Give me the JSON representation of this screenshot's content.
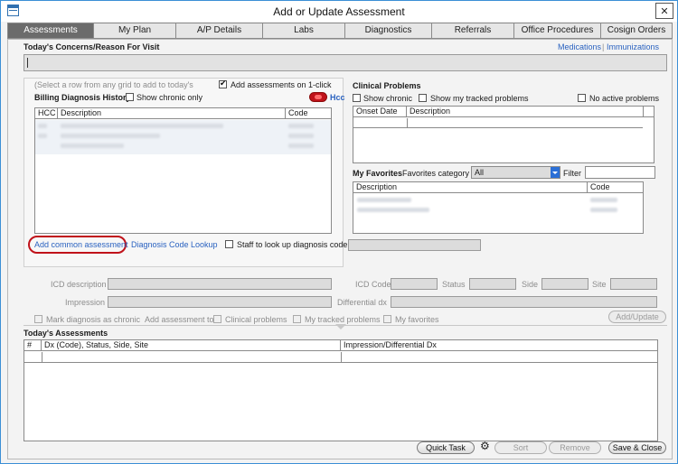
{
  "window": {
    "title": "Add or Update Assessment"
  },
  "tabs": [
    "Assessments",
    "My Plan",
    "A/P Details",
    "Labs",
    "Diagnostics",
    "Referrals",
    "Office Procedures",
    "Cosign Orders"
  ],
  "concerns": {
    "label": "Today's Concerns/Reason For Visit",
    "medications_link": "Medications",
    "separator": "|",
    "immunizations_link": "Immunizations"
  },
  "billing": {
    "instruction": "(Select a row from any grid to add to today's",
    "add_on_click_label": "Add assessments on 1-click",
    "title": "Billing Diagnosis History",
    "show_chronic_label": "Show chronic only",
    "hcc_label": "Hcc",
    "columns": [
      "HCC",
      "Description",
      "Code"
    ],
    "add_common_link": "Add common assessment",
    "code_lookup_link": "Diagnosis Code Lookup",
    "staff_lookup_label": "Staff to look up diagnosis code"
  },
  "clinical": {
    "title": "Clinical Problems",
    "show_chronic_label": "Show chronic",
    "show_tracked_label": "Show my tracked problems",
    "no_active_label": "No active problems",
    "columns": [
      "Onset Date",
      "Description"
    ]
  },
  "favorites": {
    "title": "My Favorites",
    "category_label": "Favorites category",
    "category_value": "All",
    "filter_label": "Filter",
    "columns": [
      "Description",
      "Code"
    ]
  },
  "detail_form": {
    "icd_description_label": "ICD description",
    "impression_label": "Impression",
    "icd_code_label": "ICD Code",
    "status_label": "Status",
    "side_label": "Side",
    "site_label": "Site",
    "differential_label": "Differential dx",
    "mark_chronic_label": "Mark diagnosis as chronic",
    "add_assessment_to_label": "Add assessment to",
    "clinical_problems_label": "Clinical problems",
    "tracked_problems_label": "My tracked problems",
    "my_favorites_label": "My favorites",
    "add_update_button": "Add/Update"
  },
  "todays": {
    "title": "Today's Assessments",
    "columns": [
      "#",
      "Dx (Code), Status, Side, Site",
      "Impression/Differential Dx"
    ]
  },
  "footer": {
    "quick_task": "Quick Task",
    "sort": "Sort",
    "remove": "Remove",
    "save_close": "Save & Close"
  },
  "colors": {
    "accent": "#2a62c0",
    "active_tab": "#6b6b6b",
    "highlight_circle": "#c0121a",
    "select_blue": "#2b6fd6"
  }
}
